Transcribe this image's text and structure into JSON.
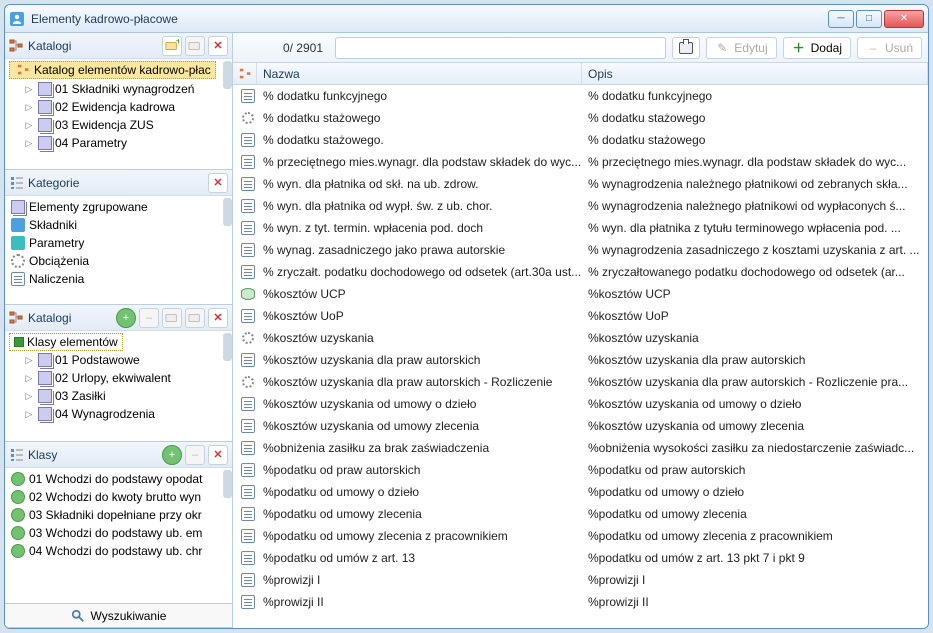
{
  "window": {
    "title": "Elementy kadrowo-płacowe"
  },
  "toolbar": {
    "counter": "0/ 2901",
    "edit": "Edytuj",
    "add": "Dodaj",
    "delete": "Usuń"
  },
  "sidebar": {
    "katalogi1": {
      "title": "Katalogi",
      "root": "Katalog elementów kadrowo-płac",
      "items": [
        "01 Składniki wynagrodzeń",
        "02 Ewidencja kadrowa",
        "03 Ewidencja ZUS",
        "04 Parametry"
      ]
    },
    "kategorie": {
      "title": "Kategorie",
      "items": [
        "Elementy zgrupowane",
        "Składniki",
        "Parametry",
        "Obciążenia",
        "Naliczenia"
      ]
    },
    "katalogi2": {
      "title": "Katalogi",
      "root": "Klasy elementów",
      "items": [
        "01 Podstawowe",
        "02 Urlopy, ekwiwalent",
        "03 Zasiłki",
        "04 Wynagrodzenia"
      ]
    },
    "klasy": {
      "title": "Klasy",
      "items": [
        "01 Wchodzi do podstawy opodat",
        "02 Wchodzi do kwoty brutto wyn",
        "03 Składniki dopełniane przy okr",
        "03 Wchodzi do podstawy ub. em",
        "04 Wchodzi do podstawy ub. chr"
      ]
    },
    "search": "Wyszukiwanie"
  },
  "columns": {
    "icon": "",
    "nazwa": "Nazwa",
    "opis": "Opis"
  },
  "rows": [
    {
      "ic": "doc",
      "n": "% dodatku funkcyjnego",
      "o": "% dodatku funkcyjnego"
    },
    {
      "ic": "gear",
      "n": "% dodatku stażowego",
      "o": "% dodatku stażowego"
    },
    {
      "ic": "doc",
      "n": "% dodatku stażowego.",
      "o": "% dodatku stażowego"
    },
    {
      "ic": "doc",
      "n": "% przeciętnego mies.wynagr. dla podstaw składek do wyc...",
      "o": "% przeciętnego mies.wynagr. dla podstaw składek do wyc..."
    },
    {
      "ic": "doc",
      "n": "% wyn. dla płatnika od skł. na ub. zdrow.",
      "o": "% wynagrodzenia należnego płatnikowi od zebranych skła..."
    },
    {
      "ic": "doc",
      "n": "% wyn. dla płatnika od wypł. św. z ub. chor.",
      "o": "% wynagrodzenia należnego płatnikowi od wypłaconych ś..."
    },
    {
      "ic": "doc",
      "n": "% wyn. z tyt. termin. wpłacenia pod. doch",
      "o": "% wyn. dla płatnika z tytułu terminowego wpłacenia pod. ..."
    },
    {
      "ic": "doc",
      "n": "% wynag. zasadniczego jako prawa autorskie",
      "o": "% wynagrodzenia zasadniczego z kosztami uzyskania z art. ..."
    },
    {
      "ic": "doc",
      "n": "% zryczałt. podatku dochodowego od odsetek (art.30a ust...",
      "o": "% zryczałtowanego podatku dochodowego od odsetek (ar..."
    },
    {
      "ic": "db",
      "n": "%kosztów UCP",
      "o": "%kosztów UCP"
    },
    {
      "ic": "doc",
      "n": "%kosztów UoP",
      "o": "%kosztów UoP"
    },
    {
      "ic": "gear",
      "n": "%kosztów uzyskania",
      "o": "%kosztów uzyskania"
    },
    {
      "ic": "doc",
      "n": "%kosztów uzyskania dla praw autorskich",
      "o": "%kosztów uzyskania dla praw autorskich"
    },
    {
      "ic": "gear",
      "n": "%kosztów uzyskania dla praw autorskich - Rozliczenie",
      "o": "%kosztów uzyskania dla praw autorskich - Rozliczenie pra..."
    },
    {
      "ic": "doc",
      "n": "%kosztów uzyskania od umowy o dzieło",
      "o": "%kosztów uzyskania od umowy o dzieło"
    },
    {
      "ic": "doc",
      "n": "%kosztów uzyskania od umowy zlecenia",
      "o": "%kosztów uzyskania od umowy zlecenia"
    },
    {
      "ic": "doc",
      "n": "%obniżenia zasiłku za brak zaświadczenia",
      "o": "%obniżenia wysokości zasiłku za niedostarczenie zaświadc..."
    },
    {
      "ic": "doc",
      "n": "%podatku od praw autorskich",
      "o": "%podatku od praw autorskich"
    },
    {
      "ic": "doc",
      "n": "%podatku od umowy o dzieło",
      "o": "%podatku od umowy o dzieło"
    },
    {
      "ic": "doc",
      "n": "%podatku od umowy zlecenia",
      "o": "%podatku od umowy zlecenia"
    },
    {
      "ic": "doc",
      "n": "%podatku od umowy zlecenia z pracownikiem",
      "o": "%podatku od umowy zlecenia z pracownikiem"
    },
    {
      "ic": "doc",
      "n": "%podatku od umów z art. 13",
      "o": "%podatku od umów z art. 13 pkt 7 i pkt 9"
    },
    {
      "ic": "doc",
      "n": "%prowizji I",
      "o": "%prowizji I"
    },
    {
      "ic": "doc",
      "n": "%prowizji II",
      "o": "%prowizji II"
    }
  ]
}
